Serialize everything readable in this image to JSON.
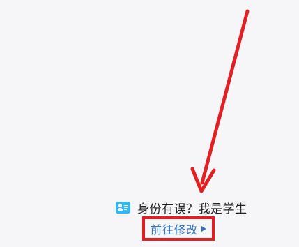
{
  "identity_prompt": {
    "icon": "id-card-icon",
    "text": "身份有误？我是学生"
  },
  "edit_link": {
    "label": "前往修改",
    "icon": "play-triangle-icon"
  },
  "annotation": {
    "color": "#e21f23"
  },
  "colors": {
    "background": "#f6f6f8",
    "link": "#2e72c4",
    "icon_bg": "#35b6f2"
  }
}
